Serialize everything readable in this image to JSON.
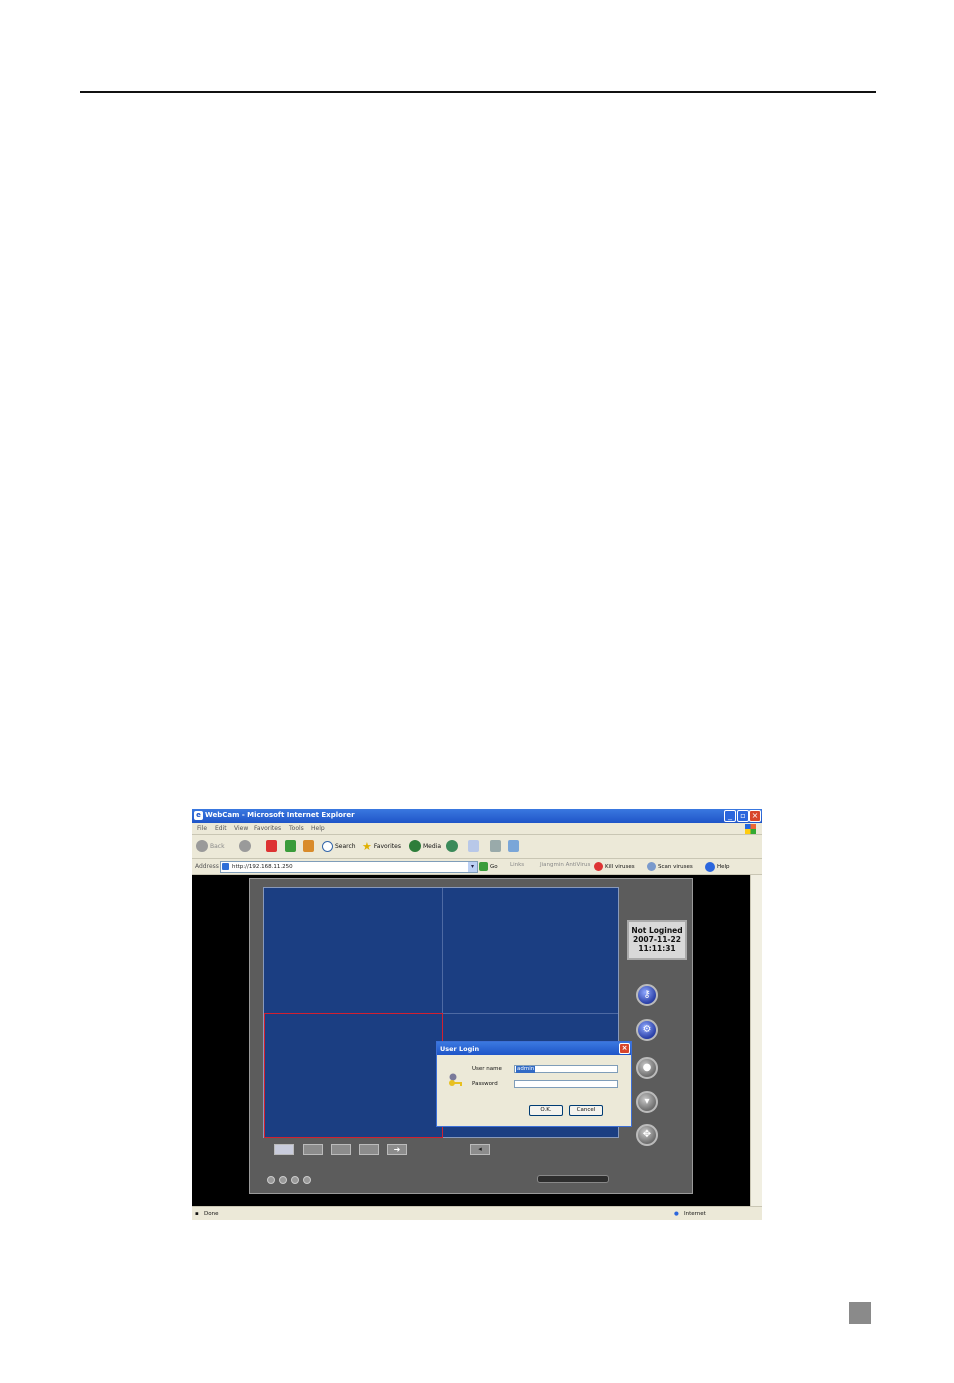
{
  "window": {
    "title": "WebCam - Microsoft Internet Explorer"
  },
  "menu": [
    "File",
    "Edit",
    "View",
    "Favorites",
    "Tools",
    "Help"
  ],
  "toolbar": {
    "back": "Back",
    "search": "Search",
    "favorites": "Favorites",
    "media": "Media"
  },
  "address": {
    "label": "Address",
    "url": "http://192.168.11.250",
    "go": "Go",
    "links": "Links",
    "antivirus": "Jiangmin AntiVirus",
    "kill": "Kill viruses",
    "scan": "Scan viruses",
    "help": "Help"
  },
  "app": {
    "status_line1": "Not Logined",
    "status_date": "2007-11-22",
    "status_time": "11:11:31"
  },
  "dialog": {
    "title": "User Login",
    "username_label": "User name",
    "username_value": "admin",
    "password_label": "Password",
    "ok": "O.K.",
    "cancel": "Cancel"
  },
  "statusbar": {
    "left": "Done",
    "zone": "Internet"
  },
  "colors": {
    "titlebar": "#1f55c8",
    "video_bg": "#1b3e82",
    "selected_border": "#d12030",
    "panel": "#5c5c5c"
  }
}
